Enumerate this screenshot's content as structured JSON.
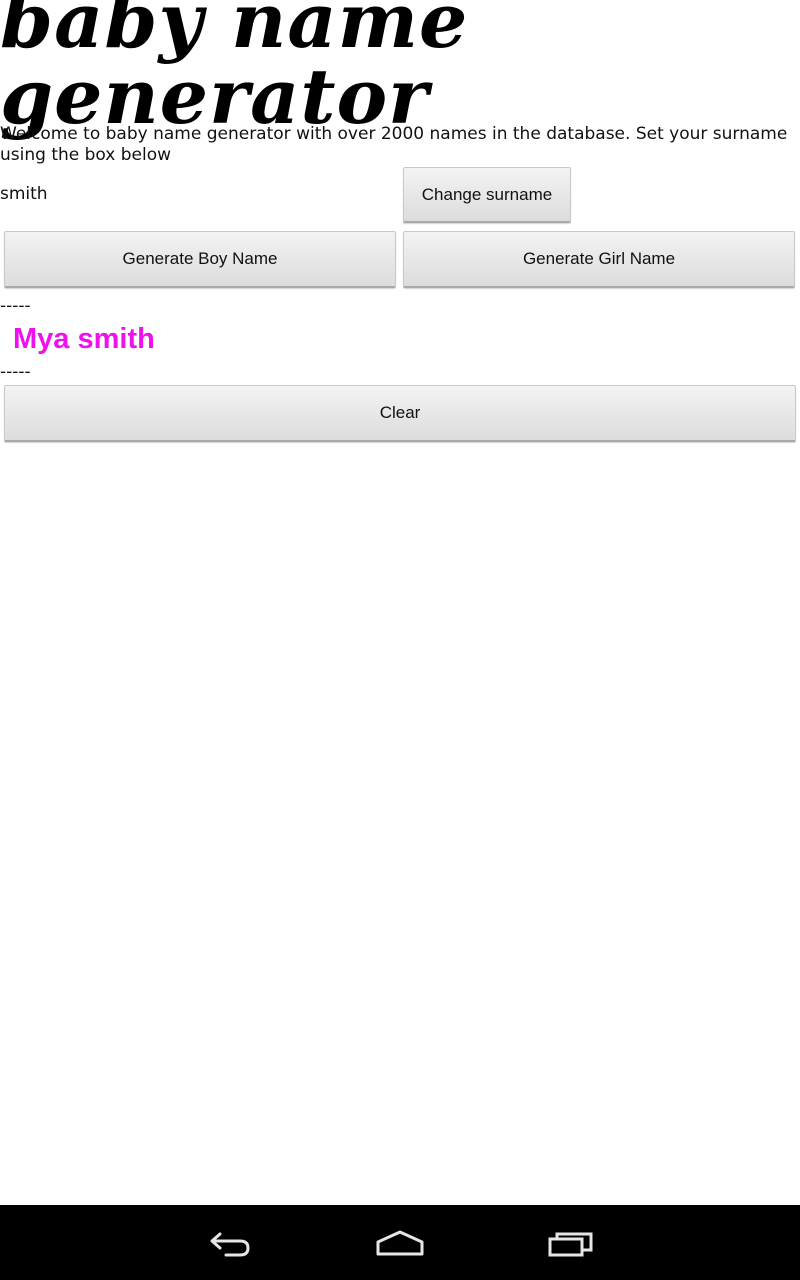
{
  "header": {
    "logo_text": "baby name generator"
  },
  "intro": {
    "text": "Welcome to baby name generator with over 2000 names in the database. Set your surname using the box below"
  },
  "surname": {
    "value": "smith",
    "change_label": "Change surname"
  },
  "actions": {
    "boy_label": "Generate Boy Name",
    "girl_label": "Generate Girl Name",
    "clear_label": "Clear"
  },
  "result": {
    "separator_top": "-----",
    "name": "Mya smith",
    "separator_bottom": "-----",
    "color": "#ee11ee"
  },
  "navbar": {
    "icons": [
      "back-icon",
      "home-icon",
      "recent-apps-icon"
    ]
  }
}
